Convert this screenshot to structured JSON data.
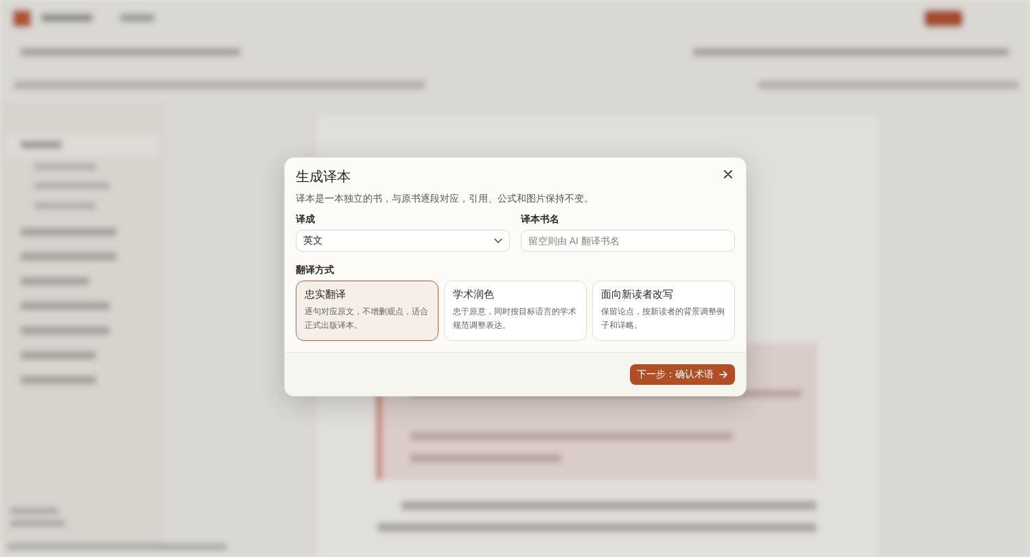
{
  "dialog": {
    "title": "生成译本",
    "description": "译本是一本独立的书，与原书逐段对应，引用、公式和图片保持不变。",
    "target_language": {
      "label": "译成",
      "value": "英文"
    },
    "book_title": {
      "label": "译本书名",
      "placeholder": "留空则由 AI 翻译书名"
    },
    "mode_label": "翻译方式",
    "modes": [
      {
        "title": "忠实翻译",
        "description": "逐句对应原文，不增删观点，适合正式出版译本。",
        "selected": true
      },
      {
        "title": "学术润色",
        "description": "忠于原意，同时按目标语言的学术规范调整表达。",
        "selected": false
      },
      {
        "title": "面向新读者改写",
        "description": "保留论点，按新读者的背景调整例子和详略。",
        "selected": false
      }
    ],
    "next_button": "下一步：确认术语"
  }
}
